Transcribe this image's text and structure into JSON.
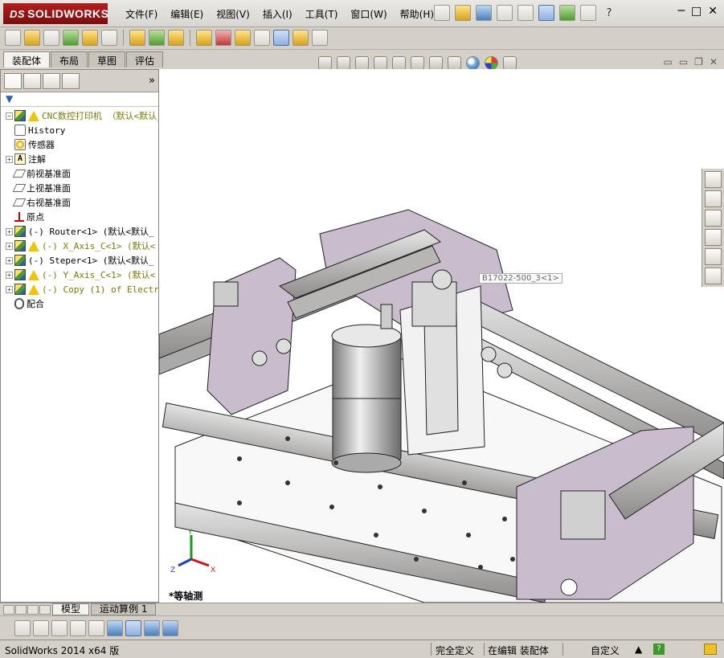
{
  "app": {
    "logo_text": "SOLIDWORKS",
    "logo_prefix": "DS"
  },
  "menu": [
    "文件(F)",
    "编辑(E)",
    "视图(V)",
    "插入(I)",
    "工具(T)",
    "窗口(W)",
    "帮助(H)"
  ],
  "title_tools": {
    "help": "?",
    "minimize": "─",
    "restore": "□",
    "close": "✕"
  },
  "tabs": [
    "装配体",
    "布局",
    "草图",
    "评估"
  ],
  "panel": {
    "filter_label": "▼",
    "more_label": "»",
    "tree": [
      {
        "label": "CNC数控打印机  （默认<默认_",
        "icon": "assembly",
        "warn": true,
        "expand": "",
        "style": "yellow"
      },
      {
        "label": "History",
        "icon": "history",
        "expand": "none"
      },
      {
        "label": "传感器",
        "icon": "sensor",
        "expand": "none"
      },
      {
        "label": "注解",
        "icon": "annotation",
        "expand": "+"
      },
      {
        "label": "前视基准面",
        "icon": "plane",
        "expand": "none"
      },
      {
        "label": "上视基准面",
        "icon": "plane",
        "expand": "none"
      },
      {
        "label": "右视基准面",
        "icon": "plane",
        "expand": "none"
      },
      {
        "label": "原点",
        "icon": "origin",
        "expand": "none"
      },
      {
        "label": "(-) Router<1> (默认<默认_",
        "icon": "assembly",
        "expand": "+"
      },
      {
        "label": "(-) X_Axis_C<1> (默认<",
        "icon": "assembly",
        "warn": true,
        "expand": "+",
        "style": "yellow"
      },
      {
        "label": "(-) Steper<1> (默认<默认_",
        "icon": "assembly",
        "expand": "+"
      },
      {
        "label": "(-) Y_Axis_C<1> (默认<",
        "icon": "assembly",
        "warn": true,
        "expand": "+",
        "style": "yellow"
      },
      {
        "label": "(-) Copy (1) of Electro",
        "icon": "assembly",
        "warn": true,
        "expand": "+",
        "style": "yellow"
      },
      {
        "label": "配合",
        "icon": "mate",
        "expand": "none"
      }
    ]
  },
  "graphics": {
    "tooltip": "B17022-500_3<1>",
    "view_label": "*等轴测",
    "triad": {
      "y": "Y",
      "z": "Z",
      "x": "X"
    }
  },
  "bottom_tabs": [
    "模型",
    "运动算例 1"
  ],
  "status": {
    "left": "SolidWorks 2014 x64 版",
    "defined": "完全定义",
    "editing": "在编辑 装配体",
    "custom": "自定义",
    "help": "?"
  },
  "colors": {
    "brand": "#a51616",
    "part_purple": "#c9bccd",
    "rail": "#b8b6b4"
  }
}
